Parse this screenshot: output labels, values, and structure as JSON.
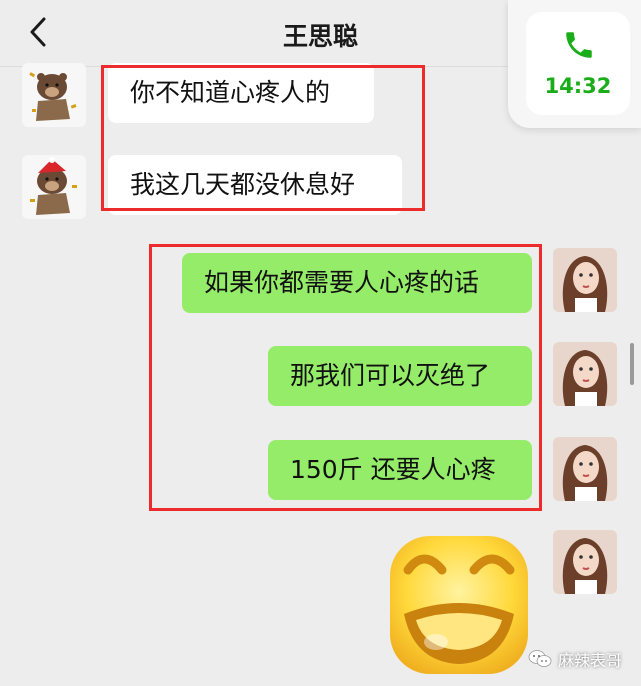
{
  "header": {
    "title": "王思聪",
    "back_icon": "chevron-left-icon"
  },
  "call_card": {
    "icon": "phone-icon",
    "time": "14:32",
    "color": "#1aad19"
  },
  "messages": [
    {
      "side": "in",
      "text": "你不知道心疼人的"
    },
    {
      "side": "in",
      "text": "我这几天都没休息好"
    },
    {
      "side": "out",
      "text": "如果你都需要人心疼的话"
    },
    {
      "side": "out",
      "text": "那我们可以灭绝了"
    },
    {
      "side": "out",
      "text": "150斤 还要人心疼"
    },
    {
      "side": "out",
      "sticker": "laughing-emoji-sticker"
    }
  ],
  "colors": {
    "incoming_bubble": "#ffffff",
    "outgoing_bubble": "#95ec69",
    "highlight_box": "#ee2b2b",
    "background": "#ededed"
  },
  "watermark": {
    "text": "麻辣表哥",
    "icon": "wechat-icon"
  }
}
